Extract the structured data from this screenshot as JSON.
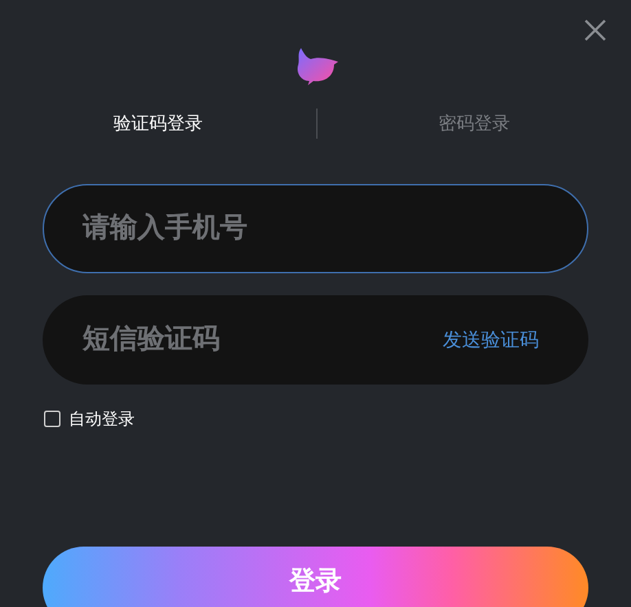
{
  "tabs": [
    {
      "label": "验证码登录",
      "selected": true
    },
    {
      "label": "密码登录",
      "selected": false
    }
  ],
  "phone_field": {
    "placeholder": "请输入手机号",
    "focused": true
  },
  "code_field": {
    "placeholder": "短信验证码",
    "focused": false
  },
  "send_code_link": "发送验证码",
  "auto_login": {
    "label": "自动登录",
    "checked": false
  },
  "login_button": "登录"
}
